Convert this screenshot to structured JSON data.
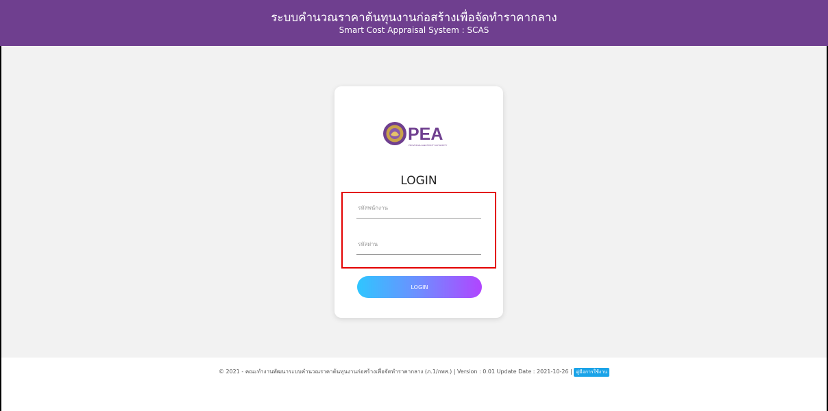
{
  "header": {
    "title": "ระบบคำนวณราคาต้นทุนงานก่อสร้างเพื่อจัดทำราคากลาง",
    "subtitle": "Smart Cost Appraisal System : SCAS"
  },
  "login": {
    "logo_text": "PEA",
    "logo_subtext": "PROVINCIAL ELECTRICITY AUTHORITY",
    "title": "LOGIN",
    "username_placeholder": "รหัสพนักงาน",
    "password_placeholder": "รหัสผ่าน",
    "button_label": "LOGIN"
  },
  "footer": {
    "text": "© 2021 - คณะทำงานพัฒนาระบบคำนวณราคาต้นทุนงานก่อสร้างเพื่อจัดทำราคากลาง (ภ.1/กพส.) | Version : 0.01 Update Date : 2021-10-26 |",
    "manual_label": "คู่มือการใช้งาน"
  },
  "colors": {
    "header_bg": "#6f3f8f",
    "highlight_border": "#e30000",
    "button_gradient_start": "#2fc6ff",
    "button_gradient_end": "#b145ff"
  }
}
